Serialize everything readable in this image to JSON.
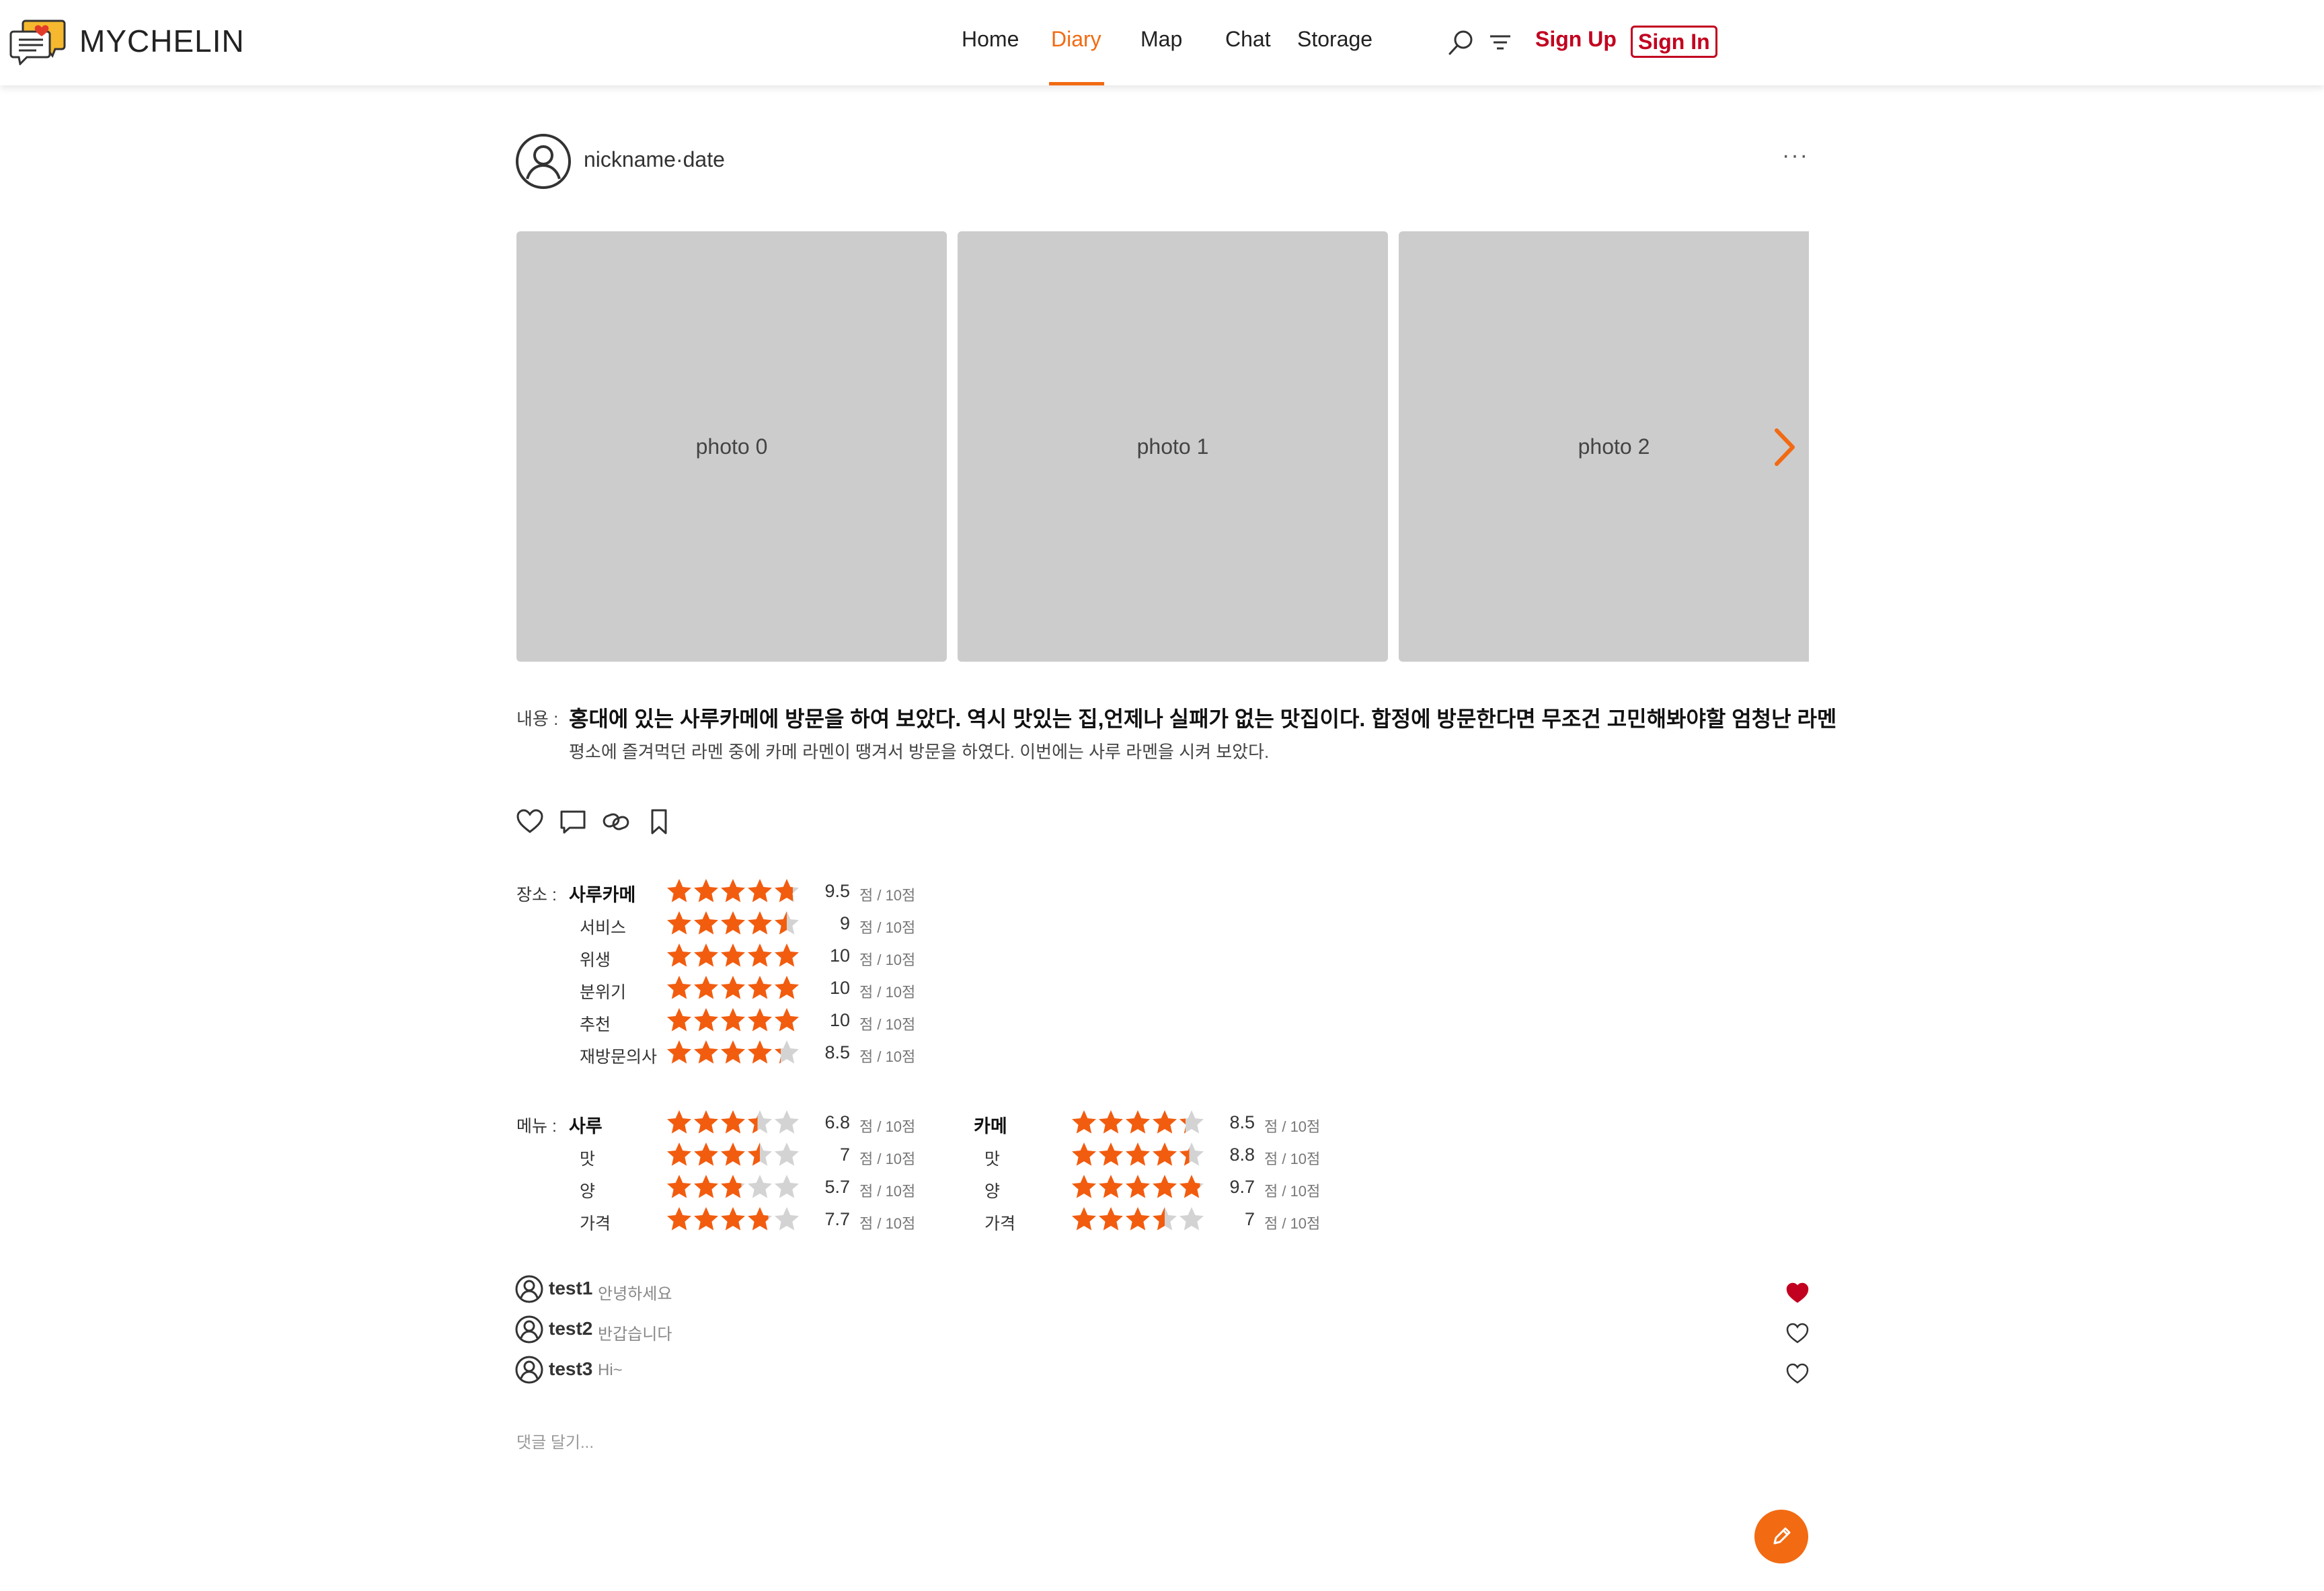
{
  "colors": {
    "accent": "#f26a12",
    "brand_red": "#c2001f",
    "star_on": "#f25c0f",
    "star_off": "#d3d3d3",
    "photo_bg": "#cccccc"
  },
  "header": {
    "logo_text": "MYCHELIN",
    "nav": [
      "Home",
      "Diary",
      "Map",
      "Chat",
      "Storage"
    ],
    "active_nav": "Diary",
    "icons": [
      "search-icon",
      "filter-icon"
    ],
    "sign_up": "Sign Up",
    "sign_in": "Sign In"
  },
  "post": {
    "nickname": "nickname",
    "separator": "·",
    "date": "date",
    "more": "···",
    "photos": [
      "photo 0",
      "photo 1",
      "photo 2"
    ],
    "content_label": "내용 :",
    "title": "홍대에 있는 사루카메에 방문을 하여 보았다. 역시 맛있는 집,언제나 실패가 없는 맛집이다. 합정에 방문한다면 무조건 고민해봐야할 엄청난 라멘",
    "body": "평소에 즐겨먹던 라멘 중에 카메 라멘이 땡겨서 방문을 하였다. 이번에는 사루 라멘을 시켜 보았다.",
    "actions": [
      "heart-icon",
      "comment-icon",
      "link-icon",
      "bookmark-icon"
    ]
  },
  "place_rating": {
    "label": "장소 :",
    "unit": "점 / 10점",
    "rows": [
      {
        "name": "사루카메",
        "value": "9.5",
        "score": 9.5
      },
      {
        "name": "서비스",
        "value": "9",
        "score": 9
      },
      {
        "name": "위생",
        "value": "10",
        "score": 10
      },
      {
        "name": "분위기",
        "value": "10",
        "score": 10
      },
      {
        "name": "추천",
        "value": "10",
        "score": 10
      },
      {
        "name": "재방문의사",
        "value": "8.5",
        "score": 8.5
      }
    ]
  },
  "menu_rating": {
    "label": "메뉴 :",
    "unit": "점 / 10점",
    "menus": [
      {
        "rows": [
          {
            "name": "사루",
            "value": "6.8",
            "score": 6.8
          },
          {
            "name": "맛",
            "value": "7",
            "score": 7
          },
          {
            "name": "양",
            "value": "5.7",
            "score": 5.7
          },
          {
            "name": "가격",
            "value": "7.7",
            "score": 7.7
          }
        ]
      },
      {
        "rows": [
          {
            "name": "카메",
            "value": "8.5",
            "score": 8.5
          },
          {
            "name": "맛",
            "value": "8.8",
            "score": 8.8
          },
          {
            "name": "양",
            "value": "9.7",
            "score": 9.7
          },
          {
            "name": "가격",
            "value": "7",
            "score": 7
          }
        ]
      }
    ]
  },
  "comments": [
    {
      "user": "test1",
      "text": "안녕하세요",
      "liked": true
    },
    {
      "user": "test2",
      "text": "반갑습니다",
      "liked": false
    },
    {
      "user": "test3",
      "text": "Hi~",
      "liked": false
    }
  ],
  "comment_input": {
    "placeholder": "댓글 달기...",
    "value": ""
  },
  "fab_icon": "pencil-icon"
}
